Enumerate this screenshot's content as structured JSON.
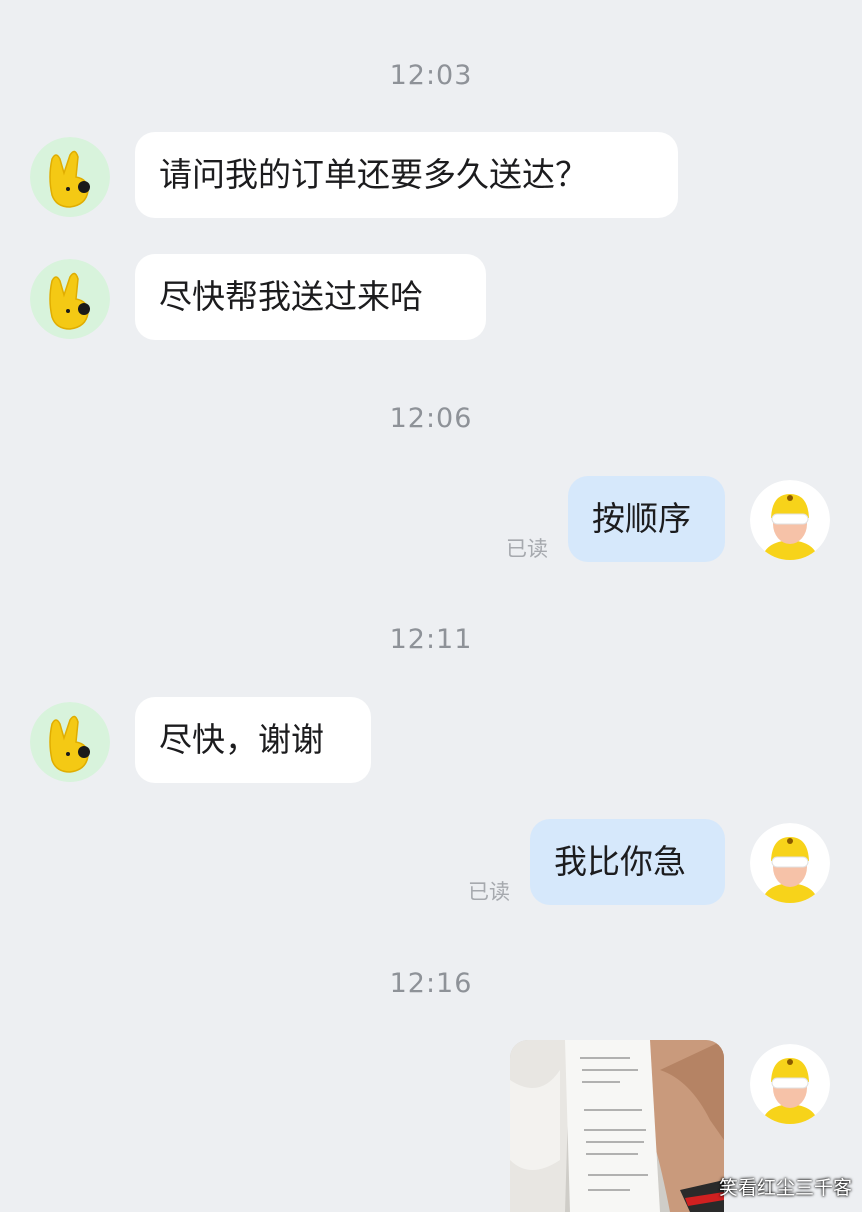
{
  "messages": [
    {
      "time": "12:03"
    },
    {
      "text": "请问我的订单还要多久送达？"
    },
    {
      "text": "尽快帮我送过来哈"
    },
    {
      "time": "12:06"
    },
    {
      "text": "按顺序",
      "status": "已读"
    },
    {
      "time": "12:11"
    },
    {
      "text": "尽快，谢谢"
    },
    {
      "text": "我比你急",
      "status": "已读"
    },
    {
      "time": "12:16"
    }
  ],
  "colors": {
    "background": "#edeff2",
    "incoming_bubble": "#ffffff",
    "outgoing_bubble": "#d6e8fb",
    "customer_avatar_bg": "#d8f3dc",
    "courier_helmet": "#f7d31a"
  },
  "icons": {
    "customer_avatar": "yellow-hand-mascot-icon",
    "courier_avatar": "courier-helmet-avatar-icon"
  },
  "image_message": {
    "content": "photo-of-receipt"
  },
  "watermark": "笑看红尘三千客"
}
